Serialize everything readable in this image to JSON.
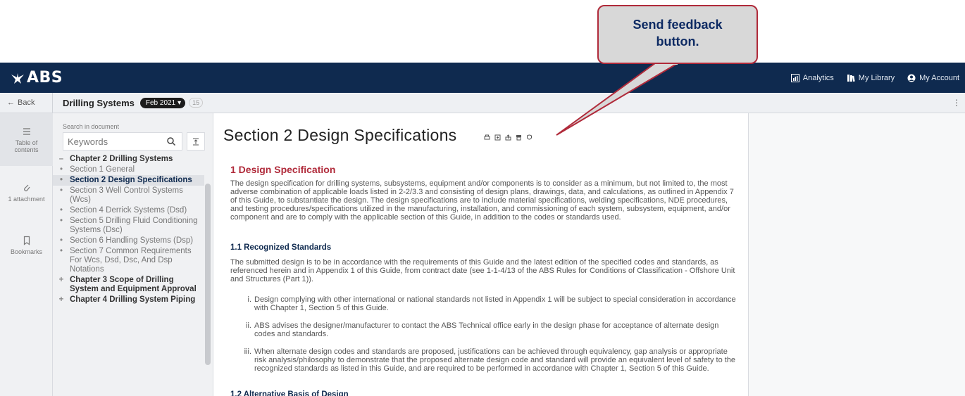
{
  "callout": {
    "text_line1": "Send feedback",
    "text_line2": "button."
  },
  "topbar": {
    "logo": "ABS",
    "nav": [
      {
        "label": "Analytics",
        "icon": "analytics-icon"
      },
      {
        "label": "My Library",
        "icon": "library-icon"
      },
      {
        "label": "My Account",
        "icon": "account-icon"
      }
    ]
  },
  "subbar": {
    "back_label": "Back",
    "doc_title": "Drilling Systems",
    "version": "Feb 2021",
    "count": "15"
  },
  "rail": [
    {
      "label": "Table of contents"
    },
    {
      "label": "1 attachment"
    },
    {
      "label": "Bookmarks"
    }
  ],
  "toc": {
    "search_label": "Search in document",
    "search_placeholder": "Keywords",
    "items": [
      {
        "mark": "–",
        "text": "Chapter 2 Drilling Systems",
        "kind": "chapter"
      },
      {
        "mark": "•",
        "text": "Section 1 General",
        "kind": "section"
      },
      {
        "mark": "•",
        "text": "Section 2 Design Specifications",
        "kind": "active"
      },
      {
        "mark": "•",
        "text": "Section 3 Well Control Systems (Wcs)",
        "kind": "section"
      },
      {
        "mark": "•",
        "text": "Section 4 Derrick Systems (Dsd)",
        "kind": "section"
      },
      {
        "mark": "•",
        "text": "Section 5 Drilling Fluid Conditioning Systems (Dsc)",
        "kind": "section"
      },
      {
        "mark": "•",
        "text": "Section 6 Handling Systems (Dsp)",
        "kind": "section"
      },
      {
        "mark": "•",
        "text": "Section 7 Common Requirements For Wcs, Dsd, Dsc, And Dsp Notations",
        "kind": "section"
      },
      {
        "mark": "+",
        "text": "Chapter 3 Scope of Drilling System and Equipment Approval",
        "kind": "chapter"
      },
      {
        "mark": "+",
        "text": "Chapter 4 Drilling System Piping",
        "kind": "chapter"
      }
    ]
  },
  "content": {
    "title": "Section 2 Design Specifications",
    "h1": "1 Design Specification",
    "p1": "The design specification for drilling systems, subsystems, equipment and/or components is to consider as a minimum, but not limited to, the most adverse combination of applicable loads listed in 2-2/3.3 and consisting of design plans, drawings, data, and calculations, as outlined in Appendix 7 of this Guide, to substantiate the design. The design specifications are to include material specifications, welding specifications, NDE procedures, and testing procedures/specifications utilized in the manufacturing, installation, and commissioning of each system, subsystem, equipment, and/or component and are to comply with the applicable section of this Guide, in addition to the codes or standards used.",
    "h2": "1.1 Recognized Standards",
    "p2": "The submitted design is to be in accordance with the requirements of this Guide and the latest edition of the specified codes and standards, as referenced herein and in Appendix 1 of this Guide, from contract date (see 1-1-4/13 of the ABS Rules for Conditions of Classification - Offshore Unit and Structures (Part 1)).",
    "list": [
      {
        "num": "i.",
        "text": "Design complying with other international or national standards not listed in Appendix 1 will be subject to special consideration in accordance with Chapter 1, Section 5 of this Guide."
      },
      {
        "num": "ii.",
        "text": "ABS advises the designer/manufacturer to contact the ABS Technical office early in the design phase for acceptance of alternate design codes and standards."
      },
      {
        "num": "iii.",
        "text": "When alternate design codes and standards are proposed, justifications can be achieved through equivalency, gap analysis or appropriate risk analysis/philosophy to demonstrate that the proposed alternate design code and standard will provide an equivalent level of safety to the recognized standards as listed in this Guide, and are required to be performed in accordance with Chapter 1, Section 5 of this Guide."
      }
    ],
    "next_heading": "1.2 Alternative Basis of Design"
  }
}
